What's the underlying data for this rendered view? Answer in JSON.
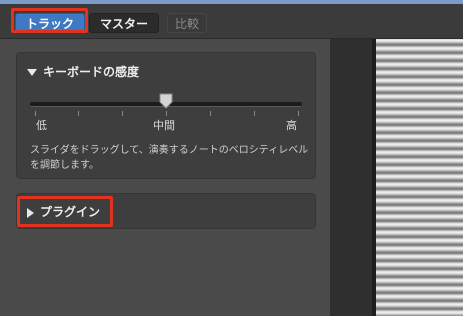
{
  "tabs": {
    "track": "トラック",
    "master": "マスター",
    "compare": "比較"
  },
  "keyboard_panel": {
    "title": "キーボードの感度",
    "low_label": "低",
    "mid_label": "中間",
    "high_label": "高",
    "slider_value": 0.5,
    "description": "スライダをドラッグして、演奏するノートのベロシティレベルを調節します。"
  },
  "plugin_panel": {
    "title": "プラグイン"
  },
  "colors": {
    "active_tab": "#3f79c3",
    "highlight": "#e0321e"
  }
}
